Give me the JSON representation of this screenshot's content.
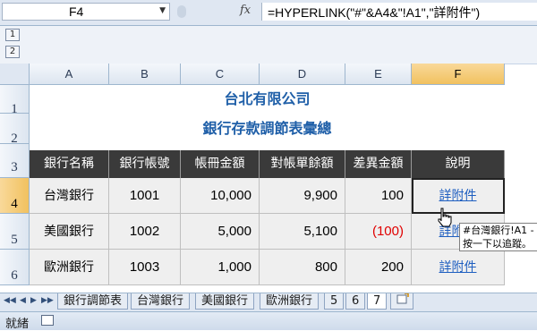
{
  "formula_bar": {
    "name_box": "F4",
    "fx_label": "fx",
    "formula": "=HYPERLINK(\"#\"&A4&\"!A1\",\"詳附件\")"
  },
  "outline": {
    "levels": [
      "1",
      "2"
    ]
  },
  "columns": [
    "A",
    "B",
    "C",
    "D",
    "E",
    "F"
  ],
  "rows": [
    "1",
    "2",
    "3",
    "4",
    "5",
    "6"
  ],
  "sheet": {
    "title1": "台北有限公司",
    "title2": "銀行存款調節表彙總",
    "headers": [
      "銀行名稱",
      "銀行帳號",
      "帳冊金額",
      "對帳單餘額",
      "差異金額",
      "說明"
    ],
    "data": [
      [
        "台灣銀行",
        "1001",
        "10,000",
        "9,900",
        "100",
        "詳附件"
      ],
      [
        "美國銀行",
        "1002",
        "5,000",
        "5,100",
        "(100)",
        "詳附件"
      ],
      [
        "歐洲銀行",
        "1003",
        "1,000",
        "800",
        "200",
        "詳附件"
      ]
    ]
  },
  "tooltip": {
    "line1": "#台灣銀行!A1 -",
    "line2": "按一下以追蹤。"
  },
  "tabs": [
    "銀行調節表",
    "台灣銀行",
    "美國銀行",
    "歐洲銀行",
    "5",
    "6",
    "7"
  ],
  "active_tab_index": 6,
  "status": "就緒",
  "colors": {
    "title": "#1f5fa8",
    "header_bg": "#3a3a3a",
    "negative": "#e00000",
    "link": "#1f5fc0"
  }
}
